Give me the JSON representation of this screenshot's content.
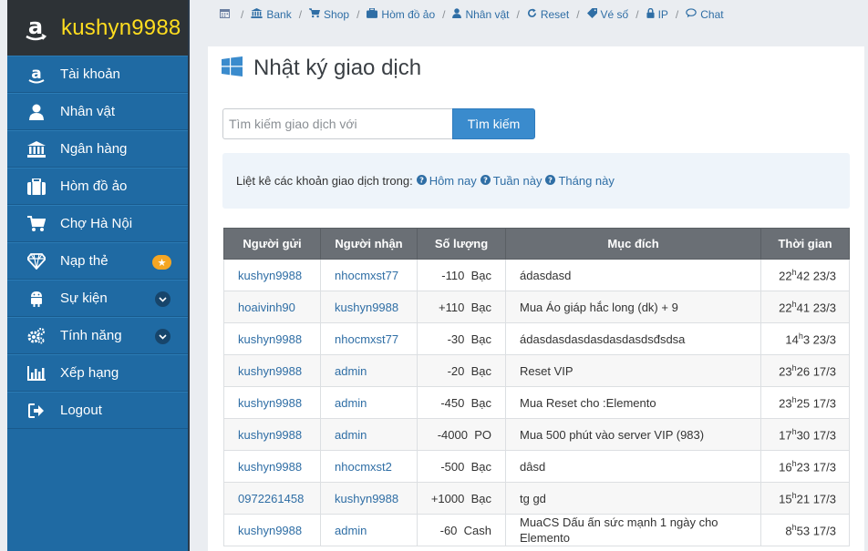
{
  "brand": {
    "name": "kushyn9988"
  },
  "sidebar": {
    "items": [
      {
        "label": "Tài khoản",
        "icon": "amazon-icon"
      },
      {
        "label": "Nhân vật",
        "icon": "user-icon"
      },
      {
        "label": "Ngân hàng",
        "icon": "bank-icon"
      },
      {
        "label": "Hòm đồ ảo",
        "icon": "briefcase-icon"
      },
      {
        "label": "Chợ Hà Nội",
        "icon": "cart-icon"
      },
      {
        "label": "Nạp thẻ",
        "icon": "diamond-icon",
        "badge": "star"
      },
      {
        "label": "Sự kiện",
        "icon": "android-icon",
        "badge": "chevron"
      },
      {
        "label": "Tính năng",
        "icon": "cogs-icon",
        "badge": "chevron"
      },
      {
        "label": "Xếp hạng",
        "icon": "bar-chart-icon"
      },
      {
        "label": "Logout",
        "icon": "sign-out-icon"
      }
    ]
  },
  "topnav": {
    "items": [
      {
        "label": "",
        "icon": "calendar-icon"
      },
      {
        "label": "Bank",
        "icon": "bank-icon"
      },
      {
        "label": "Shop",
        "icon": "cart-icon"
      },
      {
        "label": "Hòm đồ ảo",
        "icon": "briefcase-icon"
      },
      {
        "label": "Nhân vật",
        "icon": "user-icon"
      },
      {
        "label": "Reset",
        "icon": "refresh-icon"
      },
      {
        "label": "Vé số",
        "icon": "ticket-icon"
      },
      {
        "label": "IP",
        "icon": "lock-icon"
      },
      {
        "label": "Chat",
        "icon": "comment-icon"
      }
    ]
  },
  "page": {
    "title": "Nhật ký giao dịch"
  },
  "search": {
    "placeholder": "Tìm kiếm giao dịch với",
    "button": "Tìm kiếm"
  },
  "filter": {
    "prefix": "Liệt kê các khoản giao dịch trong:",
    "today": "Hôm nay",
    "week": "Tuần này",
    "month": "Tháng này"
  },
  "table": {
    "headers": [
      "Người gửi",
      "Người nhận",
      "Số lượng",
      "Mục đích",
      "Thời gian"
    ],
    "rows": [
      {
        "sender": "kushyn9988",
        "receiver": "nhocmxst77",
        "amount": "-110",
        "unit": "Bạc",
        "purpose": "ádasdasd",
        "hour": "22",
        "rest": "42 23/3"
      },
      {
        "sender": "hoaivinh90",
        "receiver": "kushyn9988",
        "amount": "+110",
        "unit": "Bạc",
        "purpose": "Mua Áo giáp hắc long (dk) + 9",
        "hour": "22",
        "rest": "41 23/3"
      },
      {
        "sender": "kushyn9988",
        "receiver": "nhocmxst77",
        "amount": "-30",
        "unit": "Bạc",
        "purpose": "ádasdasdasdasdasdasdsđsdsa",
        "hour": "14",
        "rest": "3 23/3"
      },
      {
        "sender": "kushyn9988",
        "receiver": "admin",
        "amount": "-20",
        "unit": "Bạc",
        "purpose": "Reset VIP",
        "hour": "23",
        "rest": "26 17/3"
      },
      {
        "sender": "kushyn9988",
        "receiver": "admin",
        "amount": "-450",
        "unit": "Bạc",
        "purpose": "Mua Reset cho :Elemento",
        "hour": "23",
        "rest": "25 17/3"
      },
      {
        "sender": "kushyn9988",
        "receiver": "admin",
        "amount": "-4000",
        "unit": "PO",
        "purpose": "Mua 500 phút vào server VIP (983)",
        "hour": "17",
        "rest": "30 17/3"
      },
      {
        "sender": "kushyn9988",
        "receiver": "nhocmxst2",
        "amount": "-500",
        "unit": "Bạc",
        "purpose": "dâsd",
        "hour": "16",
        "rest": "23 17/3"
      },
      {
        "sender": "0972261458",
        "receiver": "kushyn9988",
        "amount": "+1000",
        "unit": "Bạc",
        "purpose": "tg gd",
        "hour": "15",
        "rest": "21 17/3"
      },
      {
        "sender": "kushyn9988",
        "receiver": "admin",
        "amount": "-60",
        "unit": "Cash",
        "purpose": "MuaCS Dấu ấn sức mạnh 1 ngày cho Elemento",
        "hour": "8",
        "rest": "53 17/3"
      }
    ]
  },
  "colors": {
    "sidebar": "#1f6aa3",
    "brand_bg": "#2d3236",
    "brand_text": "#ffdd1f",
    "link": "#2f6ea5",
    "button": "#3a8bcd",
    "table_header": "#6a6f75"
  }
}
